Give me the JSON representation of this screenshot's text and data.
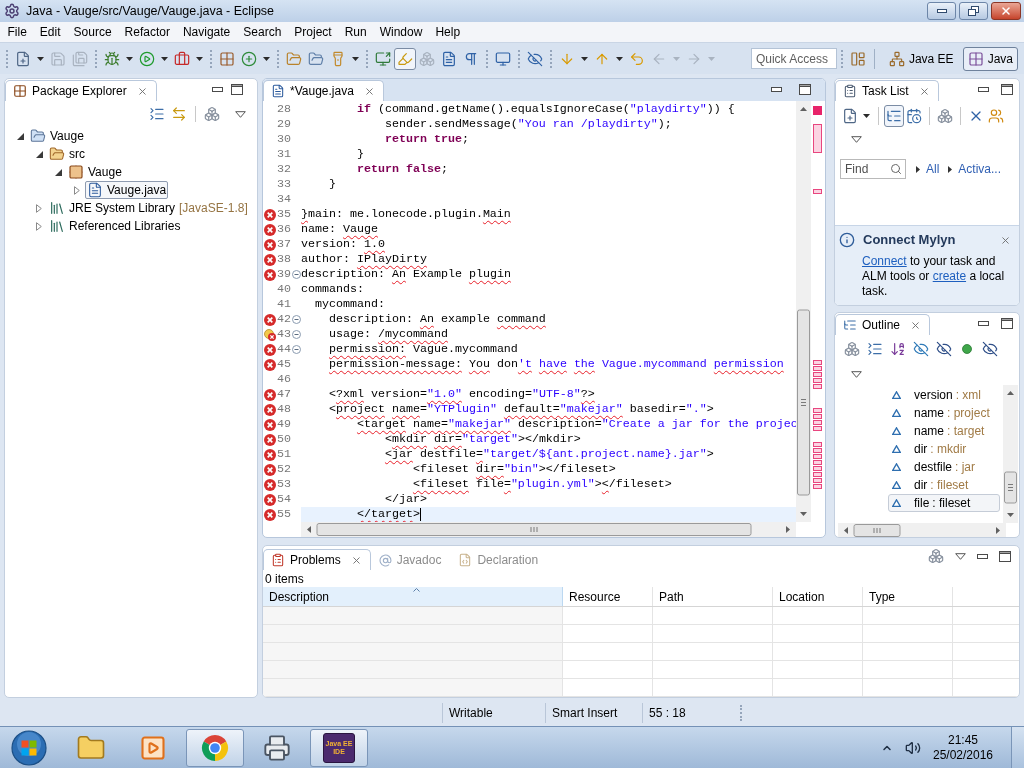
{
  "window": {
    "title": "Java - Vauge/src/Vauge/Vauge.java - Eclipse"
  },
  "menu": [
    "File",
    "Edit",
    "Source",
    "Refactor",
    "Navigate",
    "Search",
    "Project",
    "Run",
    "Window",
    "Help"
  ],
  "toolbar": {
    "groups": [
      [
        {
          "kind": "new",
          "dropdown": true,
          "disabled": false,
          "pressed": false
        },
        {
          "kind": "save",
          "dropdown": false,
          "disabled": true,
          "pressed": false
        },
        {
          "kind": "save-all",
          "dropdown": false,
          "disabled": true,
          "pressed": false
        }
      ],
      [
        {
          "kind": "debug",
          "dropdown": true,
          "disabled": false,
          "pressed": false
        },
        {
          "kind": "run",
          "dropdown": true,
          "disabled": false,
          "pressed": false
        },
        {
          "kind": "external-tools",
          "dropdown": true,
          "disabled": false,
          "pressed": false
        }
      ],
      [
        {
          "kind": "new-package",
          "dropdown": false,
          "disabled": false,
          "pressed": false
        },
        {
          "kind": "new-class",
          "dropdown": true,
          "disabled": false,
          "pressed": false
        }
      ],
      [
        {
          "kind": "open-type",
          "dropdown": false,
          "disabled": false,
          "pressed": false
        },
        {
          "kind": "open-task",
          "dropdown": false,
          "disabled": false,
          "pressed": false
        },
        {
          "kind": "search",
          "dropdown": true,
          "disabled": false,
          "pressed": false
        }
      ],
      [
        {
          "kind": "launch-screen",
          "dropdown": false,
          "disabled": false,
          "pressed": false
        },
        {
          "kind": "mark-occurrences",
          "dropdown": false,
          "disabled": false,
          "pressed": true
        },
        {
          "kind": "toggle-sync",
          "dropdown": false,
          "disabled": true,
          "pressed": false
        },
        {
          "kind": "block-selection",
          "dropdown": false,
          "disabled": false,
          "pressed": false
        },
        {
          "kind": "whitespace",
          "dropdown": false,
          "disabled": false,
          "pressed": false
        }
      ],
      [
        {
          "kind": "monitor",
          "dropdown": false,
          "disabled": false,
          "pressed": false
        }
      ],
      [
        {
          "kind": "skip-breakpoints",
          "dropdown": false,
          "disabled": false,
          "pressed": false
        }
      ],
      [
        {
          "kind": "next-annotation",
          "dropdown": true,
          "disabled": false,
          "pressed": false
        },
        {
          "kind": "previous-annotation",
          "dropdown": true,
          "disabled": false,
          "pressed": false
        },
        {
          "kind": "last-edit",
          "dropdown": false,
          "disabled": false,
          "pressed": false
        },
        {
          "kind": "back",
          "dropdown": true,
          "disabled": true,
          "pressed": false
        },
        {
          "kind": "forward",
          "dropdown": true,
          "disabled": true,
          "pressed": false
        }
      ]
    ],
    "quick_access": {
      "placeholder": "Quick Access"
    },
    "perspectives": [
      {
        "kind": "java-ee",
        "label": "Java EE",
        "selected": false
      },
      {
        "kind": "java",
        "label": "Java",
        "selected": true
      }
    ]
  },
  "package_explorer": {
    "title": "Package Explorer",
    "tree": [
      {
        "label": "Vauge",
        "kind": "project",
        "expanded": true,
        "selected": false,
        "children": [
          {
            "label": "src",
            "kind": "source-folder",
            "expanded": true,
            "selected": false,
            "children": [
              {
                "label": "Vauge",
                "kind": "package",
                "expanded": true,
                "selected": false,
                "children": [
                  {
                    "label": "Vauge.java",
                    "kind": "java-file",
                    "expanded": false,
                    "selected": true
                  }
                ]
              }
            ]
          },
          {
            "label": "JRE System Library",
            "decoration": "[JavaSE-1.8]",
            "kind": "library",
            "expanded": false,
            "selected": false
          },
          {
            "label": "Referenced Libraries",
            "kind": "library",
            "expanded": false,
            "selected": false
          }
        ]
      }
    ]
  },
  "editor": {
    "tabs": [
      {
        "label": "*Vauge.java",
        "selected": true
      }
    ],
    "lines": [
      {
        "number": "28",
        "error": false,
        "quickfix": false,
        "fold": false,
        "current": false,
        "tokens": [
          {
            "text": "        if",
            "kind": "keyword",
            "squiggle": false
          },
          {
            "text": " (command.getName().equalsIgnoreCase(",
            "kind": "text",
            "squiggle": false
          },
          {
            "text": "\"playdirty\"",
            "kind": "string",
            "squiggle": false
          },
          {
            "text": ")) {",
            "kind": "text",
            "squiggle": false
          }
        ]
      },
      {
        "number": "29",
        "error": false,
        "quickfix": false,
        "fold": false,
        "current": false,
        "tokens": [
          {
            "text": "            sender.sendMessage(",
            "kind": "text",
            "squiggle": false
          },
          {
            "text": "\"You ran /playdirty\"",
            "kind": "string",
            "squiggle": false
          },
          {
            "text": ");",
            "kind": "text",
            "squiggle": false
          }
        ]
      },
      {
        "number": "30",
        "error": false,
        "quickfix": false,
        "fold": false,
        "current": false,
        "tokens": [
          {
            "text": "            return",
            "kind": "keyword",
            "squiggle": false
          },
          {
            "text": " true",
            "kind": "keyword",
            "squiggle": false
          },
          {
            "text": ";",
            "kind": "text",
            "squiggle": false
          }
        ]
      },
      {
        "number": "31",
        "error": false,
        "quickfix": false,
        "fold": false,
        "current": false,
        "tokens": [
          {
            "text": "        }",
            "kind": "text",
            "squiggle": false
          }
        ]
      },
      {
        "number": "32",
        "error": false,
        "quickfix": false,
        "fold": false,
        "current": false,
        "tokens": [
          {
            "text": "        return",
            "kind": "keyword",
            "squiggle": false
          },
          {
            "text": " false",
            "kind": "keyword",
            "squiggle": false
          },
          {
            "text": ";",
            "kind": "text",
            "squiggle": false
          }
        ]
      },
      {
        "number": "33",
        "error": false,
        "quickfix": false,
        "fold": false,
        "current": false,
        "tokens": [
          {
            "text": "    }",
            "kind": "text",
            "squiggle": false
          }
        ]
      },
      {
        "number": "34",
        "error": false,
        "quickfix": false,
        "fold": false,
        "current": false
      },
      {
        "number": "35",
        "error": true,
        "quickfix": false,
        "fold": false,
        "current": false,
        "tokens": [
          {
            "text": "}",
            "kind": "text",
            "squiggle": true
          },
          {
            "text": "main: me.lonecode.plugin.",
            "kind": "text",
            "squiggle": false
          },
          {
            "text": "Main",
            "kind": "text",
            "squiggle": true
          }
        ]
      },
      {
        "number": "36",
        "error": true,
        "quickfix": false,
        "fold": false,
        "current": false,
        "tokens": [
          {
            "text": "name: ",
            "kind": "text",
            "squiggle": false
          },
          {
            "text": "Vauge",
            "kind": "text",
            "squiggle": true
          }
        ]
      },
      {
        "number": "37",
        "error": true,
        "quickfix": false,
        "fold": false,
        "current": false,
        "tokens": [
          {
            "text": "version: ",
            "kind": "text",
            "squiggle": false
          },
          {
            "text": "1.0",
            "kind": "text",
            "squiggle": true
          }
        ]
      },
      {
        "number": "38",
        "error": true,
        "quickfix": false,
        "fold": false,
        "current": false,
        "tokens": [
          {
            "text": "author: ",
            "kind": "text",
            "squiggle": false
          },
          {
            "text": "IPlayDirty",
            "kind": "text",
            "squiggle": true
          }
        ]
      },
      {
        "number": "39",
        "error": true,
        "quickfix": false,
        "fold": true,
        "current": false,
        "tokens": [
          {
            "text": "description: ",
            "kind": "text",
            "squiggle": false
          },
          {
            "text": "An",
            "kind": "text",
            "squiggle": true
          },
          {
            "text": " Example ",
            "kind": "text",
            "squiggle": false
          },
          {
            "text": "plugin",
            "kind": "text",
            "squiggle": true
          }
        ]
      },
      {
        "number": "40",
        "error": false,
        "quickfix": false,
        "fold": false,
        "current": false,
        "tokens": [
          {
            "text": "commands:",
            "kind": "text",
            "squiggle": false
          }
        ]
      },
      {
        "number": "41",
        "error": false,
        "quickfix": false,
        "fold": false,
        "current": false,
        "tokens": [
          {
            "text": "  mycommand:",
            "kind": "text",
            "squiggle": false
          }
        ]
      },
      {
        "number": "42",
        "error": true,
        "quickfix": false,
        "fold": true,
        "current": false,
        "tokens": [
          {
            "text": "    description: ",
            "kind": "text",
            "squiggle": false
          },
          {
            "text": "An",
            "kind": "text",
            "squiggle": true
          },
          {
            "text": " example ",
            "kind": "text",
            "squiggle": false
          },
          {
            "text": "command",
            "kind": "text",
            "squiggle": true
          }
        ]
      },
      {
        "number": "43",
        "error": true,
        "quickfix": true,
        "fold": true,
        "current": false,
        "tokens": [
          {
            "text": "    usage: ",
            "kind": "text",
            "squiggle": false
          },
          {
            "text": "/mycommand",
            "kind": "text",
            "squiggle": true
          }
        ]
      },
      {
        "number": "44",
        "error": true,
        "quickfix": false,
        "fold": true,
        "current": false,
        "tokens": [
          {
            "text": "    permission:",
            "kind": "text",
            "squiggle": true
          },
          {
            "text": " Vague.mycommand",
            "kind": "text",
            "squiggle": false
          }
        ]
      },
      {
        "number": "45",
        "error": true,
        "quickfix": false,
        "fold": false,
        "current": false,
        "tokens": [
          {
            "text": "    permission-message:",
            "kind": "text",
            "squiggle": true
          },
          {
            "text": " You",
            "kind": "text",
            "squiggle": true
          },
          {
            "text": " don",
            "kind": "text",
            "squiggle": false
          },
          {
            "text": "'t",
            "kind": "string",
            "squiggle": true
          },
          {
            "text": " have",
            "kind": "string",
            "squiggle": true
          },
          {
            "text": " the",
            "kind": "string",
            "squiggle": true
          },
          {
            "text": " Vague.mycommand ",
            "kind": "string",
            "squiggle": false
          },
          {
            "text": "permission",
            "kind": "string",
            "squiggle": true
          }
        ]
      },
      {
        "number": "46",
        "error": false,
        "quickfix": false,
        "fold": false,
        "current": false
      },
      {
        "number": "47",
        "error": true,
        "quickfix": false,
        "fold": false,
        "current": false,
        "tokens": [
          {
            "text": "    <",
            "kind": "text",
            "squiggle": false
          },
          {
            "text": "?xml",
            "kind": "text",
            "squiggle": true
          },
          {
            "text": " version=",
            "kind": "text",
            "squiggle": false
          },
          {
            "text": "\"1.0\"",
            "kind": "string",
            "squiggle": true
          },
          {
            "text": " encoding=",
            "kind": "text",
            "squiggle": false
          },
          {
            "text": "\"UTF-8\"",
            "kind": "string",
            "squiggle": false
          },
          {
            "text": "?>",
            "kind": "text",
            "squiggle": true
          }
        ]
      },
      {
        "number": "48",
        "error": true,
        "quickfix": false,
        "fold": false,
        "current": false,
        "tokens": [
          {
            "text": "    <",
            "kind": "text",
            "squiggle": false
          },
          {
            "text": "project",
            "kind": "text",
            "squiggle": true
          },
          {
            "text": " name",
            "kind": "text",
            "squiggle": true
          },
          {
            "text": "=",
            "kind": "text",
            "squiggle": false
          },
          {
            "text": "\"YTPlugin\"",
            "kind": "string",
            "squiggle": false
          },
          {
            "text": " default=",
            "kind": "text",
            "squiggle": true
          },
          {
            "text": "\"makejar\"",
            "kind": "string",
            "squiggle": true
          },
          {
            "text": " basedir=",
            "kind": "text",
            "squiggle": false
          },
          {
            "text": "\".\"",
            "kind": "string",
            "squiggle": false
          },
          {
            "text": ">",
            "kind": "text",
            "squiggle": false
          }
        ]
      },
      {
        "number": "49",
        "error": true,
        "quickfix": false,
        "fold": false,
        "current": false,
        "tokens": [
          {
            "text": "        <target",
            "kind": "text",
            "squiggle": true
          },
          {
            "text": " name=",
            "kind": "text",
            "squiggle": true
          },
          {
            "text": "\"makejar\"",
            "kind": "string",
            "squiggle": true
          },
          {
            "text": " description=",
            "kind": "text",
            "squiggle": false
          },
          {
            "text": "\"Create a jar for the projec",
            "kind": "string",
            "squiggle": false
          }
        ]
      },
      {
        "number": "50",
        "error": true,
        "quickfix": false,
        "fold": false,
        "current": false,
        "tokens": [
          {
            "text": "            <",
            "kind": "text",
            "squiggle": false
          },
          {
            "text": "mkdir",
            "kind": "text",
            "squiggle": true
          },
          {
            "text": " dir=",
            "kind": "text",
            "squiggle": true
          },
          {
            "text": "\"target\"",
            "kind": "string",
            "squiggle": false
          },
          {
            "text": "></mkdir>",
            "kind": "text",
            "squiggle": false
          }
        ]
      },
      {
        "number": "51",
        "error": true,
        "quickfix": false,
        "fold": false,
        "current": false,
        "tokens": [
          {
            "text": "            <jar",
            "kind": "text",
            "squiggle": true
          },
          {
            "text": " destfile",
            "kind": "text",
            "squiggle": false
          },
          {
            "text": "=",
            "kind": "text",
            "squiggle": true
          },
          {
            "text": "\"target/${ant.project.name}.jar\"",
            "kind": "string",
            "squiggle": false
          },
          {
            "text": ">",
            "kind": "text",
            "squiggle": false
          }
        ]
      },
      {
        "number": "52",
        "error": true,
        "quickfix": false,
        "fold": false,
        "current": false,
        "tokens": [
          {
            "text": "                <fileset ",
            "kind": "text",
            "squiggle": false
          },
          {
            "text": "dir=",
            "kind": "text",
            "squiggle": true
          },
          {
            "text": "\"bin\"",
            "kind": "string",
            "squiggle": false
          },
          {
            "text": "></fileset>",
            "kind": "text",
            "squiggle": false
          }
        ]
      },
      {
        "number": "53",
        "error": true,
        "quickfix": false,
        "fold": false,
        "current": false,
        "tokens": [
          {
            "text": "                <fileset",
            "kind": "text",
            "squiggle": true
          },
          {
            "text": " file",
            "kind": "text",
            "squiggle": false
          },
          {
            "text": "=",
            "kind": "text",
            "squiggle": true
          },
          {
            "text": "\"plugin.yml\"",
            "kind": "string",
            "squiggle": false
          },
          {
            "text": ">",
            "kind": "text",
            "squiggle": false
          },
          {
            "text": "<",
            "kind": "text",
            "squiggle": true
          },
          {
            "text": "/fileset>",
            "kind": "text",
            "squiggle": false
          }
        ]
      },
      {
        "number": "54",
        "error": true,
        "quickfix": false,
        "fold": false,
        "current": false,
        "tokens": [
          {
            "text": "            </jar>",
            "kind": "text",
            "squiggle": false
          }
        ]
      },
      {
        "number": "55",
        "error": true,
        "quickfix": false,
        "fold": false,
        "current": true,
        "tokens": [
          {
            "text": "        </target",
            "kind": "text",
            "squiggle": true
          },
          {
            "text": ">",
            "kind": "text",
            "squiggle": false
          }
        ]
      }
    ]
  },
  "task_list": {
    "title": "Task List",
    "toolbar_groups": [
      [
        {
          "kind": "new-task",
          "dropdown": true,
          "pressed": false
        }
      ],
      [
        {
          "kind": "categorized",
          "dropdown": false,
          "pressed": true
        },
        {
          "kind": "scheduled",
          "dropdown": false,
          "pressed": false
        }
      ],
      [
        {
          "kind": "sync",
          "dropdown": false,
          "pressed": false
        }
      ],
      [
        {
          "kind": "hide-completed",
          "dropdown": false,
          "pressed": false
        },
        {
          "kind": "focus",
          "dropdown": false,
          "pressed": false
        }
      ]
    ],
    "find": {
      "placeholder": "Find"
    },
    "filters": [
      "All",
      "Activa..."
    ],
    "mylyn": {
      "title": "Connect Mylyn",
      "message": [
        {
          "text": "Connect",
          "link": true
        },
        {
          "text": " to your task and ALM tools or ",
          "link": false
        },
        {
          "text": "create",
          "link": true
        },
        {
          "text": " a local task.",
          "link": false
        }
      ]
    }
  },
  "outline": {
    "title": "Outline",
    "items": [
      {
        "name": "version",
        "detail": ": xml",
        "selected": false
      },
      {
        "name": "name",
        "detail": ": project",
        "selected": false
      },
      {
        "name": "name",
        "detail": ": target",
        "selected": false
      },
      {
        "name": "dir",
        "detail": ": mkdir",
        "selected": false
      },
      {
        "name": "destfile",
        "detail": ": jar",
        "selected": false
      },
      {
        "name": "dir",
        "detail": ": fileset",
        "selected": false
      },
      {
        "name": "file",
        "detail": ": fileset",
        "selected": true
      }
    ]
  },
  "problems": {
    "tabs": [
      {
        "kind": "problems",
        "label": "Problems",
        "selected": true
      },
      {
        "kind": "javadoc",
        "label": "Javadoc",
        "selected": false
      },
      {
        "kind": "declaration",
        "label": "Declaration",
        "selected": false
      }
    ],
    "summary": "0 items",
    "columns": [
      {
        "label": "Description",
        "sorted": true
      },
      {
        "label": "Resource",
        "sorted": false
      },
      {
        "label": "Path",
        "sorted": false
      },
      {
        "label": "Location",
        "sorted": false
      },
      {
        "label": "Type",
        "sorted": false
      }
    ]
  },
  "status_bar": [
    "Writable",
    "Smart Insert",
    "55 : 18"
  ],
  "taskbar": {
    "apps": [
      {
        "kind": "folder",
        "active": false
      },
      {
        "kind": "media-player",
        "active": false
      },
      {
        "kind": "browser",
        "active": true
      },
      {
        "kind": "fax",
        "active": false
      },
      {
        "kind": "ide",
        "label": "Java EE IDE",
        "active": true
      }
    ],
    "clock": {
      "time": "21:45",
      "date": "25/02/2016"
    }
  }
}
